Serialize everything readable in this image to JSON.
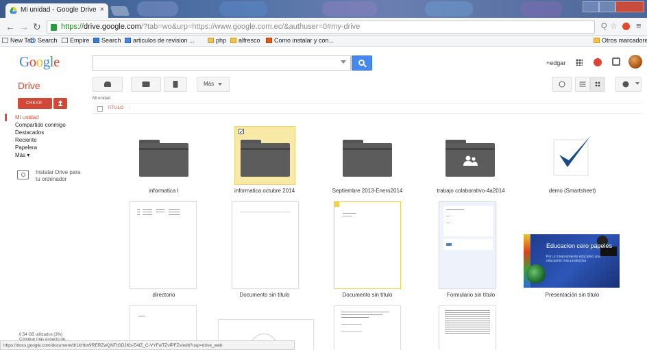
{
  "browser": {
    "tab_title": "Mi unidad - Google Drive",
    "tab_close": "×",
    "url_https": "https://",
    "url_domain": "drive.google.com",
    "url_rest": "/?tab=wo&urp=https://www.google.com.ec/&authuser=0#my-drive",
    "bookmarks": [
      "New Tab",
      "Search",
      "Empire",
      "Search",
      "articulos de revision ...",
      "php",
      "alfresco",
      "Como instalar y con..."
    ],
    "other_bookmarks": "Otros marcadores",
    "status_url": "https://docs.google.com/document/d/1kHbn9RERZwQNTtGDJKb-E4IZ_C-VYFwTZvfPFZs/edit?usp=drive_web"
  },
  "header": {
    "logo_letters": [
      {
        "ch": "G",
        "color": "#4285f4"
      },
      {
        "ch": "o",
        "color": "#ea4335"
      },
      {
        "ch": "o",
        "color": "#fbbc05"
      },
      {
        "ch": "g",
        "color": "#4285f4"
      },
      {
        "ch": "l",
        "color": "#34a853"
      },
      {
        "ch": "e",
        "color": "#ea4335"
      }
    ],
    "search_placeholder": "",
    "user": "+edgar"
  },
  "drive": {
    "title": "Drive",
    "more_button": "Más",
    "breadcrumb": "Mi unidad",
    "column_title": "TÍTULO",
    "sort_arrow": "↑",
    "create_button": "CREAR",
    "accent_color": "#dd4b39"
  },
  "nav": {
    "items": [
      "Mi unidad",
      "Compartido conmigo",
      "Destacados",
      "Reciente",
      "Papelera",
      "Más ▾"
    ],
    "install_text": "Instalar Drive para tu ordenador",
    "storage_used": "0.54 GB utilizados (3%)",
    "storage_more": "Comprar más espacio de..."
  },
  "files": {
    "row1": [
      {
        "name": "informatica I",
        "type": "folder",
        "selected": false
      },
      {
        "name": "informatica octubre 2014",
        "type": "folder",
        "selected": true
      },
      {
        "name": "Septiembre 2013-Enero2014",
        "type": "folder",
        "selected": false
      },
      {
        "name": "trabajo colaborativo-4a2014",
        "type": "shared-folder",
        "selected": false
      },
      {
        "name": "demo (Smartsheet)",
        "type": "smartsheet",
        "selected": false
      }
    ],
    "row2": [
      {
        "name": "directorio",
        "type": "document"
      },
      {
        "name": "Documento sin título",
        "type": "document"
      },
      {
        "name": "Documento sin título",
        "type": "document"
      },
      {
        "name": "Formulario sin título",
        "type": "form"
      },
      {
        "name": "Presentación sin título",
        "type": "presentation"
      }
    ],
    "presentation_title": "Educacion cero papeles",
    "presentation_subtitle": "Por un mejoramiento educativo una educación más productiva"
  }
}
